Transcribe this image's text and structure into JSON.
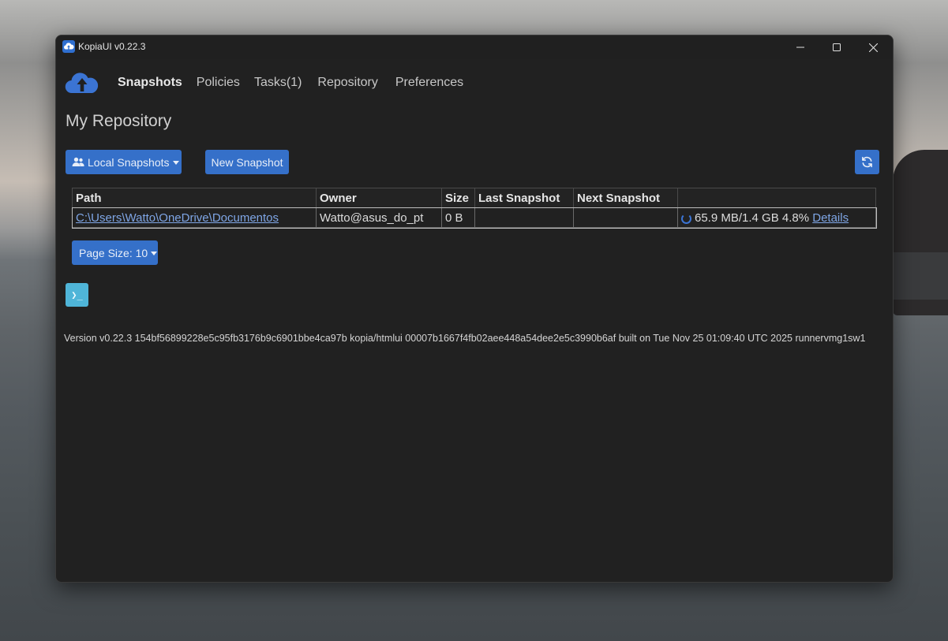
{
  "window": {
    "title": "KopiaUI v0.22.3"
  },
  "nav": {
    "items": [
      {
        "label": "Snapshots",
        "active": true
      },
      {
        "label": "Policies"
      },
      {
        "label": "Tasks(1)"
      },
      {
        "label": "Repository"
      },
      {
        "label": "Preferences"
      }
    ]
  },
  "page": {
    "title": "My Repository"
  },
  "toolbar": {
    "local_snapshots_label": "Local Snapshots",
    "new_snapshot_label": "New Snapshot",
    "refresh_icon": "refresh-icon"
  },
  "table": {
    "headers": [
      "Path",
      "Owner",
      "Size",
      "Last Snapshot",
      "Next Snapshot",
      ""
    ],
    "rows": [
      {
        "path": "C:\\Users\\Watto\\OneDrive\\Documentos",
        "owner": "Watto@asus_do_pt",
        "size": "0 B",
        "last_snapshot": "",
        "next_snapshot": "",
        "progress": "65.9 MB/1.4 GB 4.8%",
        "details_label": "Details"
      }
    ]
  },
  "pagination": {
    "page_size_label": "Page Size: 10"
  },
  "cli": {
    "icon": "terminal-icon",
    "glyph": "❯_"
  },
  "footer": {
    "version": "Version v0.22.3 154bf56899228e5c95fb3176b9c6901bbe4ca97b kopia/htmlui 00007b1667f4fb02aee448a54dee2e5c3990b6af built on Tue Nov 25 01:09:40 UTC 2025 runnervmg1sw1"
  },
  "colors": {
    "primary": "#3570c9",
    "info": "#4fb5d8",
    "link": "#7fa6e6",
    "background": "#212121"
  }
}
